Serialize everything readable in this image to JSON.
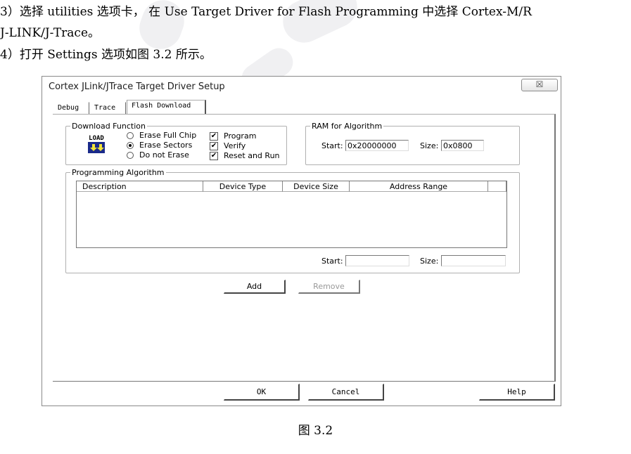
{
  "document": {
    "para3_line1": "3）选择 utilities 选项卡， 在 Use Target Driver for Flash Programming 中选择 Cortex-M/R",
    "para3_line2": "J-LINK/J-Trace。",
    "para4": "4）打开 Settings 选项如图 3.2 所示。",
    "caption": "图 3.2"
  },
  "dialog": {
    "title": "Cortex JLink/JTrace Target Driver Setup",
    "close_glyph": "☒",
    "tabs": [
      {
        "label": "Debug",
        "active": false
      },
      {
        "label": "Trace",
        "active": false
      },
      {
        "label": "Flash Download",
        "active": true
      }
    ],
    "download_function": {
      "legend": "Download Function",
      "icon_text": "LOAD",
      "radios": [
        {
          "label": "Erase Full Chip",
          "selected": false
        },
        {
          "label": "Erase Sectors",
          "selected": true
        },
        {
          "label": "Do not Erase",
          "selected": false
        }
      ],
      "checks": [
        {
          "label": "Program",
          "checked": true
        },
        {
          "label": "Verify",
          "checked": true
        },
        {
          "label": "Reset and Run",
          "checked": true
        }
      ],
      "check_glyph": "✔"
    },
    "ram": {
      "legend": "RAM for Algorithm",
      "start_label": "Start:",
      "start_value": "0x20000000",
      "size_label": "Size:",
      "size_value": "0x0800"
    },
    "programming_algorithm": {
      "legend": "Programming Algorithm",
      "columns": [
        "Description",
        "Device Type",
        "Device Size",
        "Address Range"
      ],
      "rows": [],
      "start_label": "Start:",
      "start_value": "",
      "size_label": "Size:",
      "size_value": ""
    },
    "buttons": {
      "add": "Add",
      "remove": "Remove",
      "ok": "OK",
      "cancel": "Cancel",
      "help": "Help"
    }
  }
}
